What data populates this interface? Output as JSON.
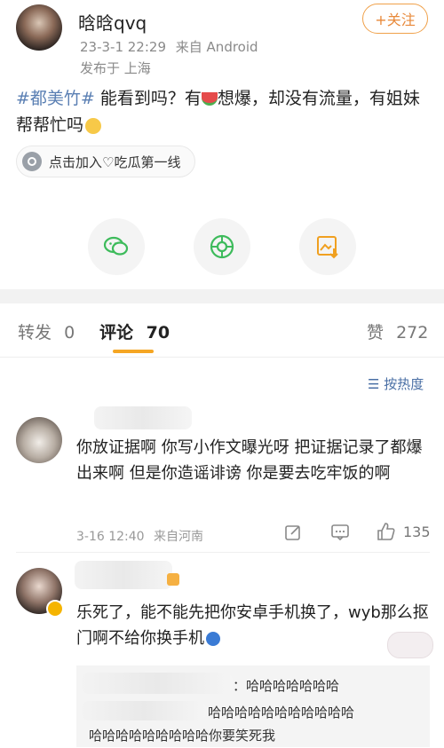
{
  "post": {
    "author": "晗晗qvq",
    "datetime": "23-3-1 22:29",
    "source": "来自 Android",
    "location": "发布于 上海",
    "follow_label": "+关注",
    "hashtag": "#都美竹#",
    "text_part1": " 能看到吗？有",
    "text_part2": "想爆，却没有流量，有姐妹帮帮忙吗",
    "chip_label": "点击加入♡吃瓜第一线"
  },
  "share_icons": [
    "wechat-icon",
    "moments-icon",
    "save-image-icon"
  ],
  "tabs": {
    "repost_label": "转发",
    "repost_count": "0",
    "comment_label": "评论",
    "comment_count": "70",
    "like_label": "赞",
    "like_count": "272"
  },
  "sort_label": "按热度",
  "comments": [
    {
      "text": "你放证据啊 你写小作文曝光呀  把证据记录了都爆出来啊 但是你造谣诽谤 你是要去吃牢饭的啊",
      "time": "3-16 12:40",
      "source": "来自河南",
      "like_count": "135"
    },
    {
      "text": "乐死了，能不能先把你安卓手机换了，wyb那么抠门啊不给你换手机",
      "reply_line1": "：哈哈哈哈哈哈哈",
      "reply_line2": "哈哈哈哈哈哈哈哈哈哈哈",
      "reply_line3": "哈哈哈哈哈哈哈哈哈你要笑死我"
    }
  ],
  "colors": {
    "accent": "#f5a623",
    "link": "#5a7fb3",
    "follow": "#e8893a"
  }
}
